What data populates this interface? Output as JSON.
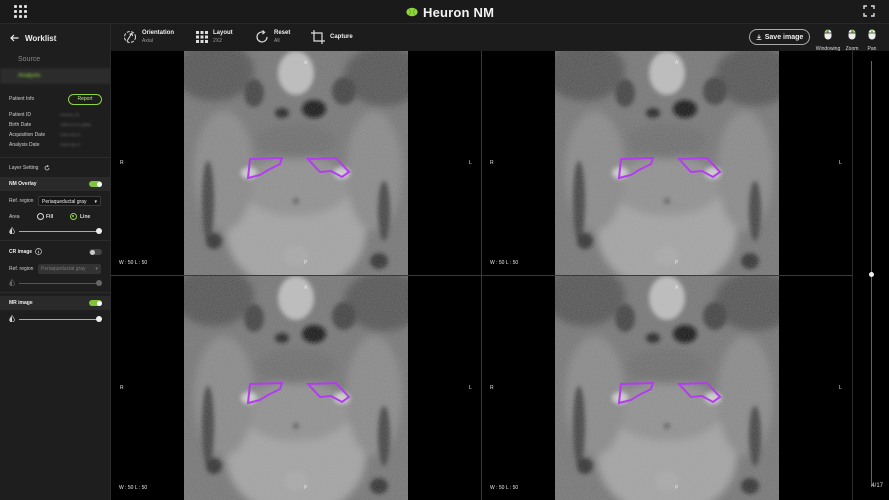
{
  "app": {
    "title": "Heuron NM",
    "brand_color": "#8fd53c"
  },
  "sidebar": {
    "back_label": "Worklist",
    "tabs": [
      {
        "label": "Source"
      },
      {
        "label": "Analysis"
      }
    ],
    "patient_info": {
      "title": "Patient Info",
      "report_label": "Report",
      "fields": [
        {
          "label": "Patient ID",
          "value": "Heuron_01"
        },
        {
          "label": "Birth Date",
          "value": "1900-01-01 (MM)"
        },
        {
          "label": "Acquisition Date",
          "value": "2022-06-21"
        },
        {
          "label": "Analysis Date",
          "value": "2022-06-27"
        }
      ]
    },
    "layer_setting": {
      "title": "Layer Setting",
      "nm_overlay": {
        "label": "NM Overlay",
        "enabled": true,
        "ref_region_label": "Ref. region",
        "ref_region_value": "Periaqueductal gray",
        "area_label": "Area",
        "fill_label": "Fill",
        "line_label": "Line",
        "area_selected": "Line",
        "opacity": 1.0
      },
      "cr_image": {
        "label": "CR image",
        "enabled": false,
        "ref_region_label": "Ref. region",
        "ref_region_value": "Periaqueductal gray",
        "opacity": 1.0
      },
      "mr_image": {
        "label": "MR image",
        "enabled": true,
        "opacity": 1.0
      }
    }
  },
  "toolbar": {
    "orientation": {
      "label": "Orientation",
      "value": "Axial",
      "icon": "orientation-icon"
    },
    "layout": {
      "label": "Layout",
      "value": "2X2",
      "icon": "grid-icon"
    },
    "reset": {
      "label": "Reset",
      "value": "All",
      "icon": "reset-icon"
    },
    "capture": {
      "label": "Capture",
      "icon": "crop-icon"
    },
    "save_label": "Save image",
    "mouse_tools": [
      {
        "label": "Windowing",
        "icon": "mouse-left-icon"
      },
      {
        "label": "Zoom",
        "icon": "mouse-right-icon"
      },
      {
        "label": "Pan",
        "icon": "mouse-wheel-icon"
      }
    ]
  },
  "viewports": [
    {
      "top": "A",
      "bottom": "P",
      "left": "R",
      "right": "L",
      "wl": "W : 50   L : 50"
    },
    {
      "top": "A",
      "bottom": "P",
      "left": "R",
      "right": "L",
      "wl": "W : 50   L : 50"
    },
    {
      "top": "A",
      "bottom": "P",
      "left": "R",
      "right": "L",
      "wl": "W : 50   L : 50"
    },
    {
      "top": "A",
      "bottom": "P",
      "left": "R",
      "right": "L",
      "wl": "W : 50   L : 50"
    }
  ],
  "slice": {
    "index": "4/17",
    "position_fraction": 0.5
  },
  "overlay_color": "#b43cf0"
}
